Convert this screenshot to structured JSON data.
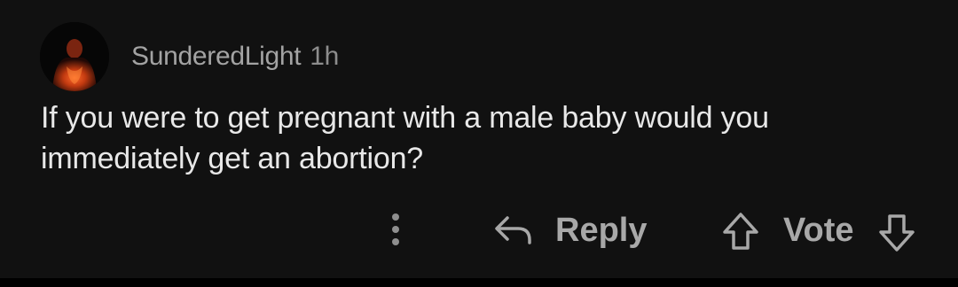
{
  "comment": {
    "author": "SunderedLight",
    "time": "1h",
    "avatar_icon": "user-avatar",
    "text": "If you were to get pregnant with a male baby would you immediately get an abortion?"
  },
  "actions": {
    "more_icon": "vertical-dots-icon",
    "reply_icon": "reply-arrow-icon",
    "reply_label": "Reply",
    "upvote_icon": "arrow-up-icon",
    "vote_label": "Vote",
    "downvote_icon": "arrow-down-icon"
  },
  "colors": {
    "background": "#111111",
    "text": "#e8e8e8",
    "muted": "#a3a3a3"
  }
}
